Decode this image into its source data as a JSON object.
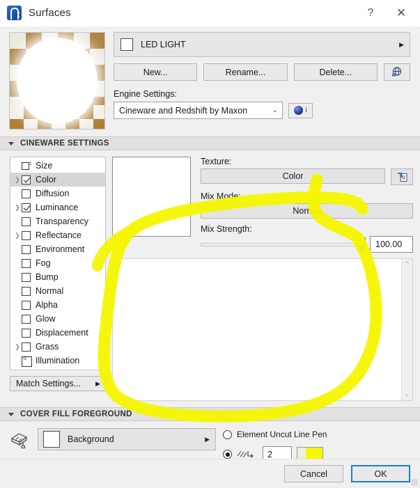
{
  "window": {
    "title": "Surfaces",
    "app_icon": "archicad-icon",
    "help_label": "?",
    "close_label": "✕"
  },
  "surface": {
    "preview_alt": "surface-preview-sphere",
    "name": "LED LIGHT",
    "expand_arrow": "▶"
  },
  "buttons": {
    "new": "New...",
    "rename": "Rename...",
    "delete": "Delete...",
    "download_icon": "globe-download-icon"
  },
  "engine": {
    "label": "Engine Settings:",
    "value": "Cineware and Redshift by Maxon",
    "chevron": "⌄",
    "info_icon": "info-icon",
    "info_letter": "i"
  },
  "cineware": {
    "header": "CINEWARE SETTINGS",
    "channels": [
      {
        "label": "Size",
        "icon": "size-icon",
        "checkbox": false,
        "checked": false,
        "expandable": false,
        "selected": false
      },
      {
        "label": "Color",
        "icon": null,
        "checkbox": true,
        "checked": true,
        "expandable": true,
        "selected": true
      },
      {
        "label": "Diffusion",
        "icon": null,
        "checkbox": true,
        "checked": false,
        "expandable": false,
        "selected": false
      },
      {
        "label": "Luminance",
        "icon": null,
        "checkbox": true,
        "checked": true,
        "expandable": true,
        "selected": false
      },
      {
        "label": "Transparency",
        "icon": null,
        "checkbox": true,
        "checked": false,
        "expandable": false,
        "selected": false
      },
      {
        "label": "Reflectance",
        "icon": null,
        "checkbox": true,
        "checked": false,
        "expandable": true,
        "selected": false
      },
      {
        "label": "Environment",
        "icon": null,
        "checkbox": true,
        "checked": false,
        "expandable": false,
        "selected": false
      },
      {
        "label": "Fog",
        "icon": null,
        "checkbox": true,
        "checked": false,
        "expandable": false,
        "selected": false
      },
      {
        "label": "Bump",
        "icon": null,
        "checkbox": true,
        "checked": false,
        "expandable": false,
        "selected": false
      },
      {
        "label": "Normal",
        "icon": null,
        "checkbox": true,
        "checked": false,
        "expandable": false,
        "selected": false
      },
      {
        "label": "Alpha",
        "icon": null,
        "checkbox": true,
        "checked": false,
        "expandable": false,
        "selected": false
      },
      {
        "label": "Glow",
        "icon": null,
        "checkbox": true,
        "checked": false,
        "expandable": false,
        "selected": false
      },
      {
        "label": "Displacement",
        "icon": null,
        "checkbox": true,
        "checked": false,
        "expandable": false,
        "selected": false
      },
      {
        "label": "Grass",
        "icon": null,
        "checkbox": true,
        "checked": false,
        "expandable": true,
        "selected": false
      },
      {
        "label": "Illumination",
        "icon": "illumination-icon",
        "checkbox": false,
        "checked": false,
        "expandable": false,
        "selected": false
      }
    ],
    "match_settings": "Match Settings...",
    "match_arrow": "▶"
  },
  "texture": {
    "texture_label": "Texture:",
    "texture_value": "Color",
    "load_icon": "load-texture-icon",
    "mix_mode_label": "Mix Mode:",
    "mix_mode_value": "Normal",
    "mix_strength_label": "Mix Strength:",
    "mix_strength_value": "100.00",
    "mix_strength_percent": 100,
    "scroll_up": "⌃",
    "scroll_down": "⌄"
  },
  "cover_fill": {
    "header": "COVER FILL FOREGROUND",
    "bucket_icon": "paint-bucket-icon",
    "fill_name": "Background",
    "fill_arrow": "▶",
    "radio_element_pen": "Element Uncut Line Pen",
    "radio_element_pen_selected": false,
    "radio_custom_pen_selected": true,
    "pen_icon": "hatch-pen-icon",
    "pen_number": "2",
    "pen_color": "#f7f700"
  },
  "footer": {
    "cancel": "Cancel",
    "ok": "OK"
  },
  "annotation": {
    "type": "freehand-highlight-oval",
    "color": "#f5f500"
  },
  "colors": {
    "accent": "#1a7fd4",
    "highlight": "#f5f500",
    "dialog_bg": "#f0f0f0"
  }
}
